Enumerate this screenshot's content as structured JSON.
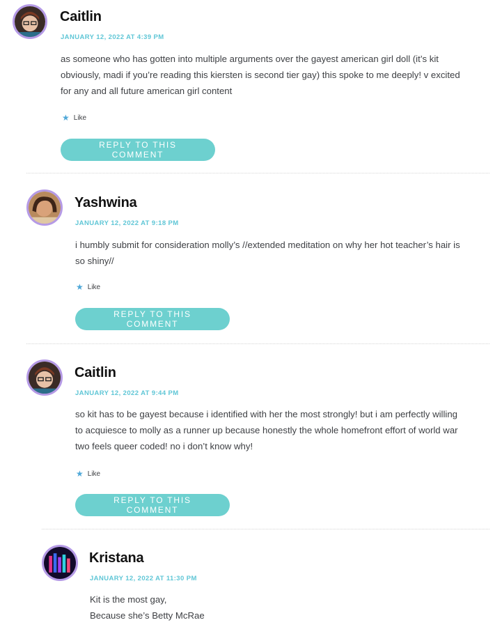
{
  "comments": [
    {
      "author": "Caitlin",
      "date": "JANUARY 12, 2022 AT 4:39 PM",
      "lines": [
        "as someone who has gotten into multiple arguments over the gayest american girl doll (it’s kit",
        "obviously, madi if you’re reading this kiersten is second tier gay) this spoke to me deeply! v excited",
        "for any and all future american girl content"
      ],
      "like_label": "Like",
      "reply_label": "REPLY TO THIS COMMENT"
    },
    {
      "author": "Yashwina",
      "date": "JANUARY 12, 2022 AT 9:18 PM",
      "lines": [
        "i humbly submit for consideration molly’s //extended meditation on why her hot teacher’s hair is",
        "so shiny//"
      ],
      "like_label": "Like",
      "reply_label": "REPLY TO THIS COMMENT"
    },
    {
      "author": "Caitlin",
      "date": "JANUARY 12, 2022 AT 9:44 PM",
      "lines": [
        "so kit has to be gayest because i identified with her the most strongly! but i am perfectly willing",
        "to acquiesce to molly as a runner up because honestly the whole homefront effort of world war",
        "two feels queer coded! no i don’t know why!"
      ],
      "like_label": "Like",
      "reply_label": "REPLY TO THIS COMMENT"
    },
    {
      "author": "Kristana",
      "date": "JANUARY 12, 2022 AT 11:30 PM",
      "lines": [
        "Kit is the most gay,",
        "Because she’s Betty McRae"
      ]
    }
  ],
  "colors": {
    "accent": "#5fc6d6",
    "reply_button": "#6dd0cf",
    "avatar_border": "#b59ae6",
    "like_star": "#4fa8d8"
  },
  "icons": {
    "like": "star-icon"
  }
}
